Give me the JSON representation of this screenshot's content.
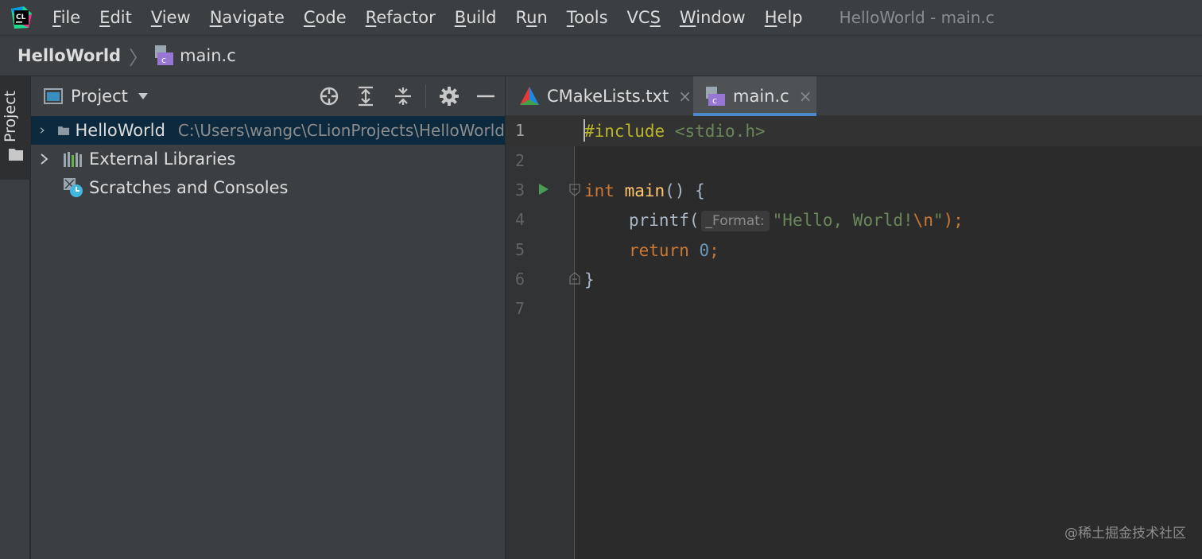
{
  "menu": {
    "items": [
      {
        "pre": "",
        "u": "F",
        "post": "ile"
      },
      {
        "pre": "",
        "u": "E",
        "post": "dit"
      },
      {
        "pre": "",
        "u": "V",
        "post": "iew"
      },
      {
        "pre": "",
        "u": "N",
        "post": "avigate"
      },
      {
        "pre": "",
        "u": "C",
        "post": "ode"
      },
      {
        "pre": "",
        "u": "R",
        "post": "efactor"
      },
      {
        "pre": "",
        "u": "B",
        "post": "uild"
      },
      {
        "pre": "R",
        "u": "u",
        "post": "n"
      },
      {
        "pre": "",
        "u": "T",
        "post": "ools"
      },
      {
        "pre": "VC",
        "u": "S",
        "post": ""
      },
      {
        "pre": "",
        "u": "W",
        "post": "indow"
      },
      {
        "pre": "",
        "u": "H",
        "post": "elp"
      }
    ],
    "window_title": "HelloWorld - main.c"
  },
  "breadcrumb": {
    "project": "HelloWorld",
    "separator": "〉",
    "file": "main.c"
  },
  "tool_stripe": {
    "label": "Project"
  },
  "project_panel": {
    "title": "Project",
    "icons": [
      "project-view-icon",
      "chevron-down-icon",
      "locate-icon",
      "expand-all-icon",
      "collapse-all-icon",
      "gear-icon",
      "minimize-icon"
    ],
    "tree": [
      {
        "label": "HelloWorld",
        "path": "C:\\Users\\wangc\\CLionProjects\\HelloWorld",
        "icon": "folder-icon",
        "expandable": true,
        "selected": true
      },
      {
        "label": "External Libraries",
        "path": "",
        "icon": "libraries-icon",
        "expandable": true,
        "selected": false
      },
      {
        "label": "Scratches and Consoles",
        "path": "",
        "icon": "scratches-icon",
        "expandable": false,
        "selected": false
      }
    ]
  },
  "tabs": [
    {
      "label": "CMakeLists.txt",
      "close": "×",
      "icon": "cmake-icon",
      "active": false
    },
    {
      "label": "main.c",
      "close": "×",
      "icon": "c-file-icon",
      "active": true
    }
  ],
  "editor": {
    "line_numbers": [
      "1",
      "2",
      "3",
      "4",
      "5",
      "6",
      "7"
    ],
    "current_line": 1,
    "lines": {
      "l1": {
        "directive": "#include",
        "header": "<stdio.h>"
      },
      "l3": {
        "type": "int",
        "fn": "main",
        "rest": "() {"
      },
      "l4": {
        "fn": "printf",
        "open": "(",
        "hint": "_Format:",
        "str_a": "\"Hello, World!",
        "esc": "\\n",
        "str_b": "\"",
        "close": ");"
      },
      "l5": {
        "kw": "return",
        "num": "0",
        "semi": ";"
      },
      "l6": {
        "text": "}"
      }
    }
  },
  "colors": {
    "keyword": "#cc7832",
    "string": "#6a8759",
    "number": "#6897bb",
    "preprocessor": "#bbb529",
    "selection": "#0d293e",
    "tab_underline": "#4a88c7"
  },
  "watermark": "@稀土掘金技术社区"
}
